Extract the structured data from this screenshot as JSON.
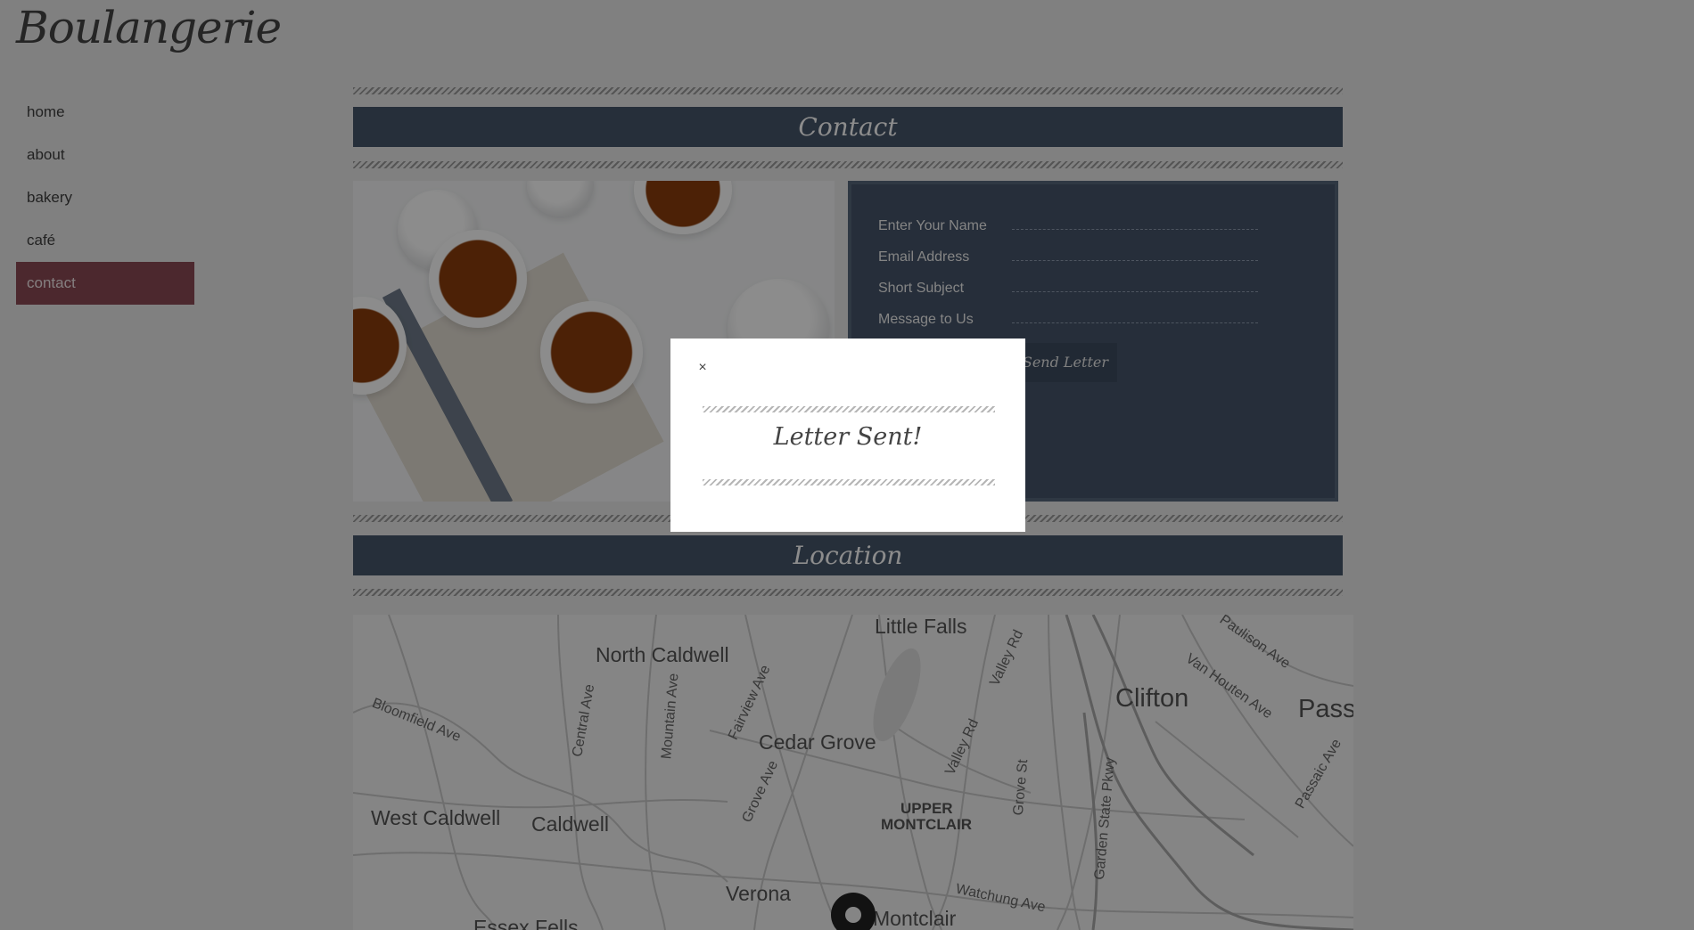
{
  "site": {
    "logo": "Boulangerie"
  },
  "nav": {
    "items": [
      {
        "label": "home"
      },
      {
        "label": "about"
      },
      {
        "label": "bakery"
      },
      {
        "label": "café"
      },
      {
        "label": "contact",
        "active": true
      }
    ]
  },
  "sections": {
    "contact_title": "Contact",
    "location_title": "Location"
  },
  "form": {
    "name_label": "Enter Your Name",
    "email_label": "Email Address",
    "subject_label": "Short Subject",
    "message_label": "Message to Us",
    "send_label": "Send Letter"
  },
  "map": {
    "places": [
      "Little Falls",
      "North Caldwell",
      "Clifton",
      "Pass",
      "Cedar Grove",
      "West Caldwell",
      "Caldwell",
      "UPPER",
      "MONTCLAIR",
      "Verona",
      "Montclair",
      "Essex Fells"
    ],
    "roads": [
      "Paulison Ave",
      "Van Houten Ave",
      "Valley Rd",
      "Central Ave",
      "Mountain Ave",
      "Fairview Ave",
      "Bloomfield Ave",
      "Valley Rd",
      "Grove Ave",
      "Grove St",
      "Garden State Pkwy",
      "Passaic Ave",
      "Watchung Ave"
    ]
  },
  "modal": {
    "close_symbol": "×",
    "title": "Letter Sent!"
  },
  "colors": {
    "banner": "#46566b",
    "nav_active": "#8a4a55",
    "overlay": "rgba(0,0,0,0.45)"
  }
}
